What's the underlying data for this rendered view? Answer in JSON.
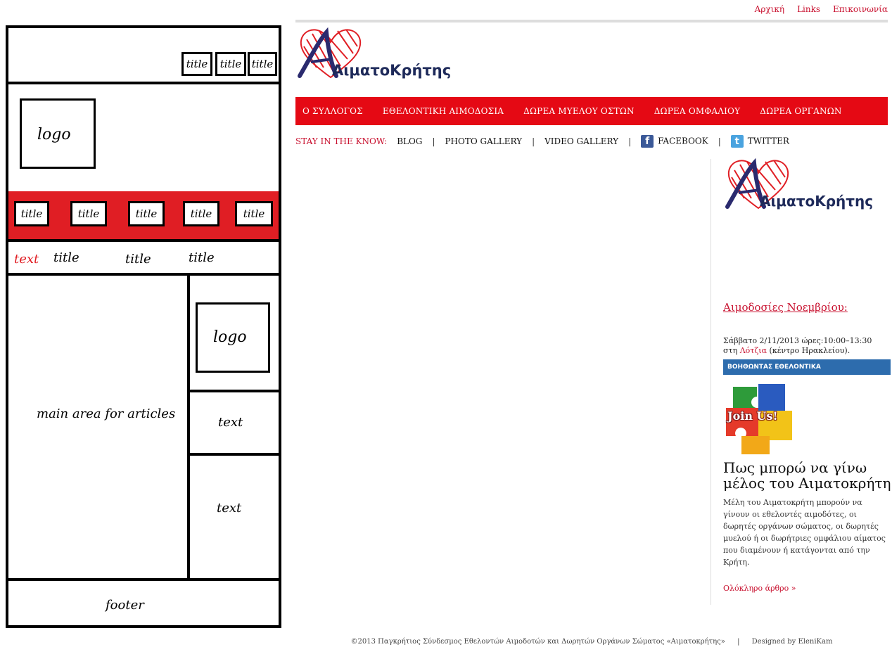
{
  "wireframe": {
    "header_titles": [
      "title",
      "title",
      "title"
    ],
    "logo_label": "logo",
    "nav_titles": [
      "title",
      "title",
      "title",
      "title",
      "title"
    ],
    "subnav_text": "text",
    "subnav_titles": [
      "title",
      "title",
      "title"
    ],
    "main_area_label": "main area for articles",
    "sidebar_logo_label": "logo",
    "sidebar_text_1": "text",
    "sidebar_text_2": "text",
    "footer_label": "footer"
  },
  "site": {
    "top_links": [
      "Αρχική",
      "Links",
      "Επικοινωνία"
    ],
    "logo": {
      "brand": "ΑιματοΚρήτης",
      "heart_color": "#e01e24",
      "text_color": "#1e2a5a"
    },
    "nav_items": [
      "Ο ΣΥΛΛΟΓΟΣ",
      "ΕΘΕΛΟΝΤΙΚΗ ΑΙΜΟΔΟΣΙΑ",
      "ΔΩΡΕΑ ΜΥΕΛΟΥ ΟΣΤΩΝ",
      "ΔΩΡΕΑ ΟΜΦΑΛΙΟΥ",
      "ΔΩΡΕΑ ΟΡΓΑΝΩΝ"
    ],
    "stay_label": "STAY IN THE KNOW:",
    "sub_links": [
      "BLOG",
      "PHOTO GALLERY",
      "VIDEO GALLERY",
      "FACEBOOK",
      "TWITTER"
    ],
    "sidebar": {
      "heading": "Αιμοδοσίες Νοεμβρίου:",
      "info_line1": "Σάββατο 2/11/2013 ώρες:10:00–13:30",
      "info_pre": "στη ",
      "info_link": "Λότζια",
      "info_post": " (κέντρο Ηρακλείου).",
      "volunteer_bar": "ΒΟΗΘΩΝΤΑΣ ΕΘΕΛΟΝΤΙΚΑ",
      "join_text": "Join Us!",
      "title": "Πως μπορώ να γίνω μέλος του Αιματοκρήτη",
      "body": "Μέλη του Αιματοκρήτη μπορούν να γίνουν οι εθελοντές αιμοδότες, οι δωρητές οργάνων σώματος, οι δωρητές μυελού ή οι δωρήτριες ομφάλιου αίματος που διαμένουν ή κατάγονται από την Κρήτη.",
      "read_more": "Ολόκληρο άρθρο »"
    },
    "footer": {
      "copyright": "©2013 Παγκρήτιος Σύνδεσμος Εθελοντών Αιμοδοτών και Δωρητών Οργάνων Σώματος «Αιματοκρήτης»",
      "separator": "|",
      "credit": "Designed by EleniKam"
    },
    "colors": {
      "nav_red": "#e50914",
      "link_red": "#c8102e",
      "volunteer_blue": "#2d6cad"
    }
  }
}
